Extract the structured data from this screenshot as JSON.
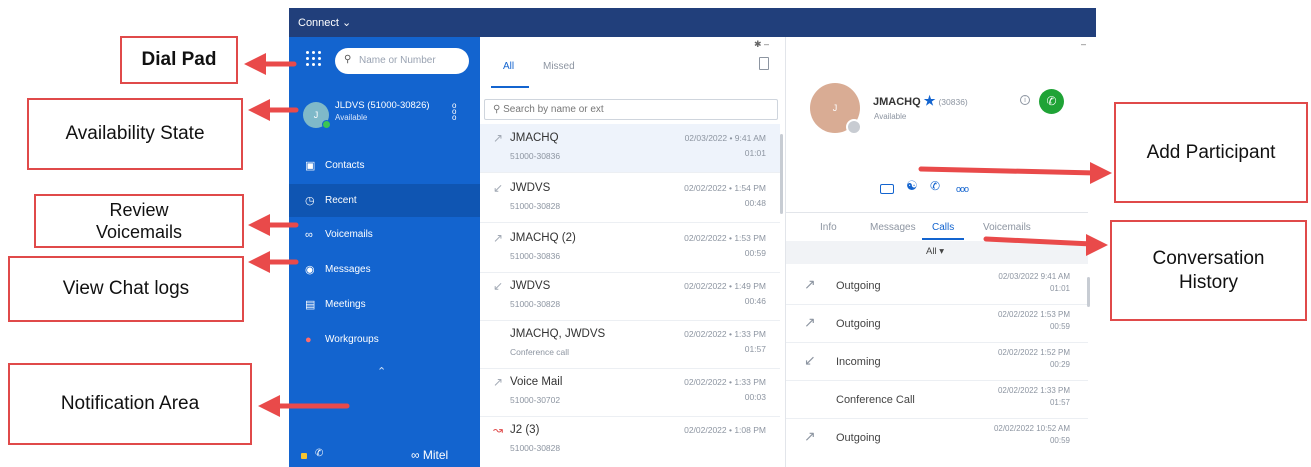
{
  "app": {
    "menu_label": "Connect",
    "brand": "Mitel"
  },
  "sidebar": {
    "search_placeholder": "Name or Number",
    "user_name": "JLDVS (51000-30826)",
    "user_status": "Available",
    "avatar_initial": "J",
    "items": [
      {
        "label": "Contacts"
      },
      {
        "label": "Recent"
      },
      {
        "label": "Voicemails"
      },
      {
        "label": "Messages"
      },
      {
        "label": "Meetings"
      },
      {
        "label": "Workgroups"
      }
    ]
  },
  "list": {
    "tabs": [
      "All",
      "Missed"
    ],
    "search_placeholder": "Search by name or ext",
    "rows": [
      {
        "name": "JMACHQ",
        "number": "51000-30836",
        "date": "02/03/2022 • 9:41 AM",
        "duration": "01:01"
      },
      {
        "name": "JWDVS",
        "number": "51000-30828",
        "date": "02/02/2022 • 1:54 PM",
        "duration": "00:48"
      },
      {
        "name": "JMACHQ (2)",
        "number": "51000-30836",
        "date": "02/02/2022 • 1:53 PM",
        "duration": "00:59"
      },
      {
        "name": "JWDVS",
        "number": "51000-30828",
        "date": "02/02/2022 • 1:49 PM",
        "duration": "00:46"
      },
      {
        "name": "JMACHQ, JWDVS",
        "number": "Conference call",
        "date": "02/02/2022 • 1:33 PM",
        "duration": "01:57"
      },
      {
        "name": "Voice Mail",
        "number": "51000-30702",
        "date": "02/02/2022 • 1:33 PM",
        "duration": "00:03"
      },
      {
        "name": "J2 (3)",
        "number": "51000-30828",
        "date": "02/02/2022 • 1:08 PM",
        "duration": ""
      }
    ]
  },
  "detail": {
    "contact_name": "JMACHQ",
    "contact_ext": "(30836)",
    "contact_status": "Available",
    "avatar_initial": "J",
    "tabs": [
      "Info",
      "Messages",
      "Calls",
      "Voicemails"
    ],
    "filter_label": "All ▾",
    "history": [
      {
        "label": "Outgoing",
        "date": "02/03/2022 9:41 AM",
        "duration": "01:01"
      },
      {
        "label": "Outgoing",
        "date": "02/02/2022 1:53 PM",
        "duration": "00:59"
      },
      {
        "label": "Incoming",
        "date": "02/02/2022 1:52 PM",
        "duration": "00:29"
      },
      {
        "label": "Conference Call",
        "date": "02/02/2022 1:33 PM",
        "duration": "01:57"
      },
      {
        "label": "Outgoing",
        "date": "02/02/2022 10:52 AM",
        "duration": "00:59"
      }
    ]
  },
  "callouts": {
    "dial_pad": "Dial Pad",
    "availability_state": "Availability State",
    "review_voicemails": "Review Voicemails",
    "view_chat_logs": "View Chat logs",
    "notification_area": "Notification Area",
    "add_participant": "Add Participant",
    "conversation_history": "Conversation History"
  },
  "colors": {
    "sidebar": "#1364cf",
    "topbar": "#213f7b",
    "callout_border": "#e04a4a",
    "arrow": "#e94a4a",
    "call_green": "#1fa336"
  }
}
